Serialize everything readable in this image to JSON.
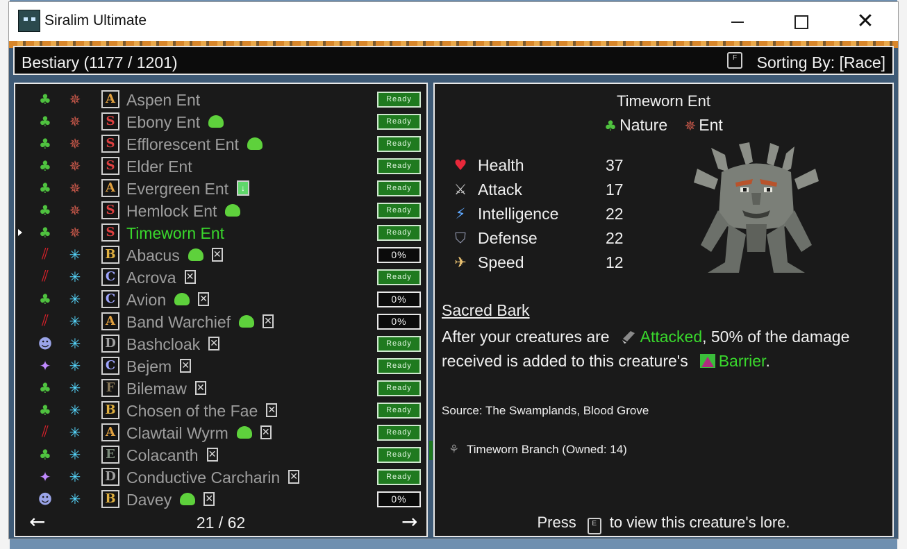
{
  "window": {
    "title": "Siralim Ultimate"
  },
  "header": {
    "title": "Bestiary (1177 / 1201)",
    "sort_key": "F",
    "sort_label": "Sorting By: [Race]"
  },
  "list": {
    "rows": [
      {
        "cls_icon": "nature-icon",
        "race_icon": "ent-race-icon",
        "rank": "A",
        "rank_color": "#e0a040",
        "name": "Aspen Ent",
        "flags": [],
        "status": "Ready",
        "status_type": "ready"
      },
      {
        "cls_icon": "nature-icon",
        "race_icon": "ent-race-icon",
        "rank": "S",
        "rank_color": "#e04040",
        "name": "Ebony Ent",
        "flags": [
          "slime"
        ],
        "status": "Ready",
        "status_type": "ready"
      },
      {
        "cls_icon": "nature-icon",
        "race_icon": "ent-race-icon",
        "rank": "S",
        "rank_color": "#e04040",
        "name": "Efflorescent Ent",
        "flags": [
          "slime"
        ],
        "status": "Ready",
        "status_type": "ready"
      },
      {
        "cls_icon": "nature-icon",
        "race_icon": "ent-race-icon",
        "rank": "S",
        "rank_color": "#e04040",
        "name": "Elder Ent",
        "flags": [],
        "status": "Ready",
        "status_type": "ready"
      },
      {
        "cls_icon": "nature-icon",
        "race_icon": "ent-race-icon",
        "rank": "A",
        "rank_color": "#e0a040",
        "name": "Evergreen Ent",
        "flags": [
          "potion"
        ],
        "status": "Ready",
        "status_type": "ready"
      },
      {
        "cls_icon": "nature-icon",
        "race_icon": "ent-race-icon",
        "rank": "S",
        "rank_color": "#e04040",
        "name": "Hemlock Ent",
        "flags": [
          "slime"
        ],
        "status": "Ready",
        "status_type": "ready"
      },
      {
        "cls_icon": "nature-icon",
        "race_icon": "ent-race-icon",
        "rank": "S",
        "rank_color": "#e04040",
        "name": "Timeworn Ent",
        "flags": [],
        "status": "Ready",
        "status_type": "ready",
        "selected": true
      },
      {
        "cls_icon": "chaos-icon",
        "race_icon": "star-race-icon",
        "rank": "B",
        "rank_color": "#e0b040",
        "name": "Abacus",
        "flags": [
          "slime",
          "x"
        ],
        "status": "0%",
        "status_type": "pct"
      },
      {
        "cls_icon": "chaos-icon",
        "race_icon": "star-race-icon",
        "rank": "C",
        "rank_color": "#9fa6ff",
        "name": "Acrova",
        "flags": [
          "x"
        ],
        "status": "Ready",
        "status_type": "ready"
      },
      {
        "cls_icon": "nature-icon",
        "race_icon": "star-race-icon",
        "rank": "C",
        "rank_color": "#9fa6ff",
        "name": "Avion",
        "flags": [
          "slime",
          "x"
        ],
        "status": "0%",
        "status_type": "pct"
      },
      {
        "cls_icon": "chaos-icon",
        "race_icon": "star-race-icon",
        "rank": "A",
        "rank_color": "#e0a040",
        "name": "Band Warchief",
        "flags": [
          "slime",
          "x"
        ],
        "status": "0%",
        "status_type": "pct"
      },
      {
        "cls_icon": "death-icon",
        "race_icon": "star-race-icon",
        "rank": "D",
        "rank_color": "#a0a0a0",
        "name": "Bashcloak",
        "flags": [
          "x"
        ],
        "status": "Ready",
        "status_type": "ready"
      },
      {
        "cls_icon": "arcane-icon",
        "race_icon": "star-race-icon",
        "rank": "C",
        "rank_color": "#9fa6ff",
        "name": "Bejem",
        "flags": [
          "x"
        ],
        "status": "Ready",
        "status_type": "ready"
      },
      {
        "cls_icon": "nature-icon",
        "race_icon": "star-race-icon",
        "rank": "F",
        "rank_color": "#8a7a5a",
        "name": "Bilemaw",
        "flags": [
          "x"
        ],
        "status": "Ready",
        "status_type": "ready"
      },
      {
        "cls_icon": "nature-icon",
        "race_icon": "star-race-icon",
        "rank": "B",
        "rank_color": "#e0b040",
        "name": "Chosen of the Fae",
        "flags": [
          "x"
        ],
        "status": "Ready",
        "status_type": "ready"
      },
      {
        "cls_icon": "chaos-icon",
        "race_icon": "star-race-icon",
        "rank": "A",
        "rank_color": "#e0a040",
        "name": "Clawtail Wyrm",
        "flags": [
          "slime",
          "x"
        ],
        "status": "Ready",
        "status_type": "ready"
      },
      {
        "cls_icon": "nature-icon",
        "race_icon": "star-race-icon",
        "rank": "E",
        "rank_color": "#7a8a7a",
        "name": "Colacanth",
        "flags": [
          "x"
        ],
        "status": "Ready",
        "status_type": "ready"
      },
      {
        "cls_icon": "arcane-icon",
        "race_icon": "star-race-icon",
        "rank": "D",
        "rank_color": "#a0a0a0",
        "name": "Conductive Carcharin",
        "flags": [
          "x"
        ],
        "status": "Ready",
        "status_type": "ready"
      },
      {
        "cls_icon": "death-icon",
        "race_icon": "star-race-icon",
        "rank": "B",
        "rank_color": "#e0b040",
        "name": "Davey",
        "flags": [
          "slime",
          "x"
        ],
        "status": "0%",
        "status_type": "pct"
      }
    ],
    "pager": "21 / 62",
    "prev_glyph": "←",
    "next_glyph": "→"
  },
  "detail": {
    "name": "Timeworn Ent",
    "class_label": "Nature",
    "race_label": "Ent",
    "stats": [
      {
        "label": "Health",
        "value": "37",
        "icon": "heart-icon",
        "glyph": "♥",
        "color": "#e8283a"
      },
      {
        "label": "Attack",
        "value": "17",
        "icon": "sword-icon",
        "glyph": "⚔",
        "color": "#c9c9c9"
      },
      {
        "label": "Intelligence",
        "value": "22",
        "icon": "bolt-icon",
        "glyph": "⚡",
        "color": "#5fa8ff"
      },
      {
        "label": "Defense",
        "value": "22",
        "icon": "shield-icon",
        "glyph": "⛉",
        "color": "#9aa0b8"
      },
      {
        "label": "Speed",
        "value": "12",
        "icon": "wing-icon",
        "glyph": "✈",
        "color": "#e8c070"
      }
    ],
    "trait_name": "Sacred Bark",
    "trait": {
      "pre1": "After your creatures are",
      "kw1": "Attacked",
      "post1": ", 50% of the damage received is added to this creature's",
      "kw2": "Barrier",
      "post2": "."
    },
    "source": "Source: The Swamplands, Blood Grove",
    "material": "Timeworn Branch (Owned: 14)",
    "press": {
      "pre": "Press",
      "key": "E",
      "post": "to view this creature's lore."
    }
  }
}
